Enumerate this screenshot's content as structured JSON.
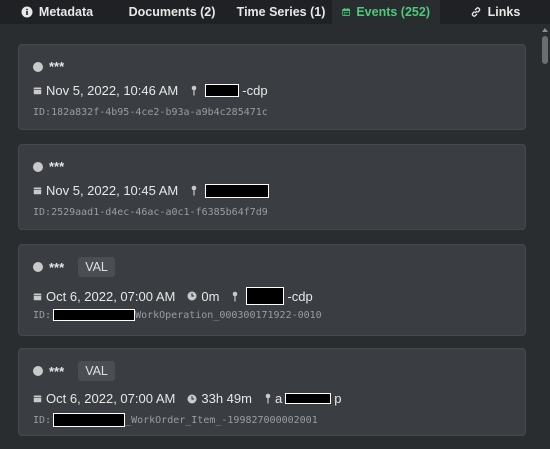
{
  "tabs": [
    {
      "label": "Metadata",
      "icon": "info-icon"
    },
    {
      "label": "Documents (2)",
      "icon": "document-icon"
    },
    {
      "label": "Time Series (1)",
      "icon": "chart-line-icon"
    },
    {
      "label": "Events (252)",
      "icon": "calendar-icon",
      "active": true
    },
    {
      "label": "Links",
      "icon": "link-icon"
    }
  ],
  "colors": {
    "accent": "#4ec97a",
    "card": "#3a3d41",
    "background": "#2a2d30"
  },
  "events": [
    {
      "title": "***",
      "badge": "",
      "date": "Nov 5, 2022, 10:46 AM",
      "duration": "",
      "asset_suffix": "-cdp",
      "id_prefix": "ID: ",
      "id_text": "182a832f-4b95-4ce2-b93a-a9b4c285471c"
    },
    {
      "title": "***",
      "badge": "",
      "date": "Nov 5, 2022, 10:45 AM",
      "duration": "",
      "asset_suffix": "",
      "id_prefix": "ID: ",
      "id_text": "2529aad1-d4ec-46ac-a0c1-f6385b64f7d9"
    },
    {
      "title": "***",
      "badge": "VAL",
      "date": "Oct 6, 2022, 07:00 AM",
      "duration": "0m",
      "asset_suffix": "-cdp",
      "id_prefix": "ID: ",
      "id_text": "WorkOperation_000300171922-0010"
    },
    {
      "title": "***",
      "badge": "VAL",
      "date": "Oct 6, 2022, 07:00 AM",
      "duration": "33h 49m",
      "asset_suffix": "p",
      "asset_prefix": "a",
      "id_prefix": "ID: ",
      "id_text": "_WorkOrder_Item_-199827000002001"
    }
  ]
}
